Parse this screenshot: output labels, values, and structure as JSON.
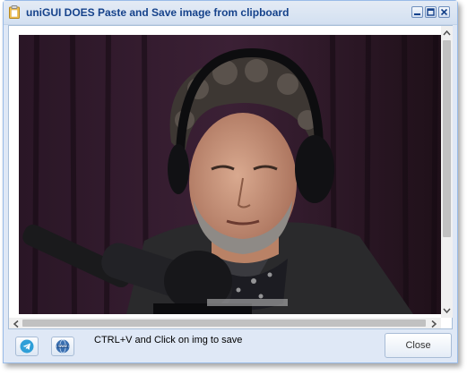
{
  "window": {
    "title": "uniGUI DOES Paste and Save image from clipboard"
  },
  "content": {
    "image_description_icon": "pasted-photo"
  },
  "footer": {
    "hint": "CTRL+V and Click on img to save",
    "close_label": "Close",
    "telegram_icon": "telegram-icon",
    "www_icon": "www-globe-icon"
  },
  "colors": {
    "title_text": "#15428b",
    "window_bg": "#dfe8f6",
    "border": "#99bbe8"
  }
}
